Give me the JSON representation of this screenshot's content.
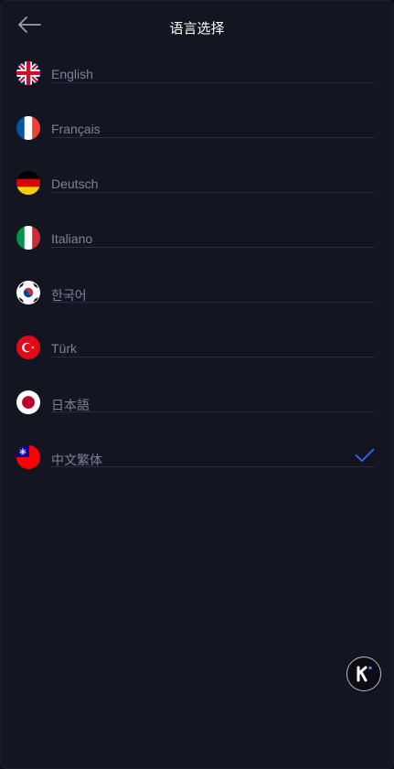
{
  "header": {
    "title": "语言选择"
  },
  "languages": [
    {
      "label": "English",
      "flag": "uk-flag-icon"
    },
    {
      "label": "Français",
      "flag": "france-flag-icon"
    },
    {
      "label": "Deutsch",
      "flag": "germany-flag-icon"
    },
    {
      "label": "Italiano",
      "flag": "italy-flag-icon"
    },
    {
      "label": "한국어",
      "flag": "korea-flag-icon"
    },
    {
      "label": "Türk",
      "flag": "turkey-flag-icon"
    },
    {
      "label": "日本語",
      "flag": "japan-flag-icon"
    },
    {
      "label": "中文繁体",
      "flag": "taiwan-flag-icon",
      "selected": true
    }
  ],
  "colors": {
    "background": "#131620",
    "accent": "#2f6bff",
    "text_muted": "#7b8199"
  }
}
